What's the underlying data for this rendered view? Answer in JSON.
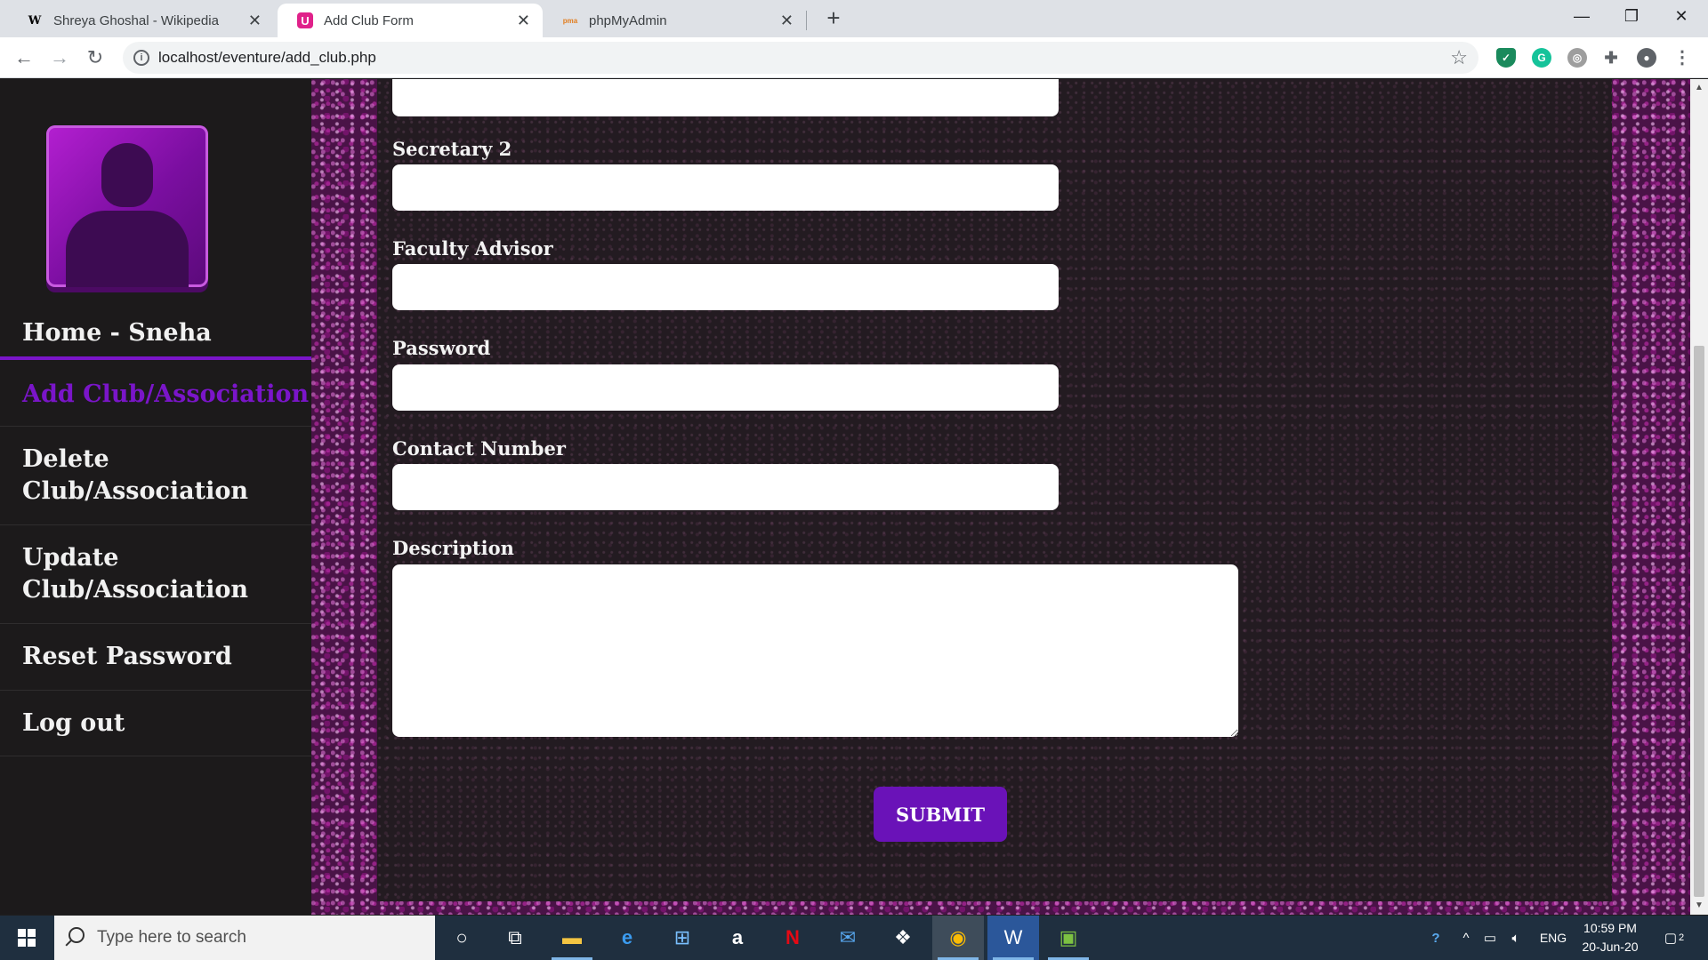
{
  "browser": {
    "tabs": [
      {
        "title": "Shreya Ghoshal - Wikipedia",
        "favicon": "W"
      },
      {
        "title": "Add Club Form",
        "favicon": "U"
      },
      {
        "title": "phpMyAdmin",
        "favicon": "pma"
      }
    ],
    "new_tab": "+",
    "url": "localhost/eventure/add_club.php"
  },
  "sidebar": {
    "avatar": "user-silhouette",
    "items": [
      {
        "label": "Home - Sneha"
      },
      {
        "label": "Add Club/Association"
      },
      {
        "label": "Delete\nClub/Association"
      },
      {
        "label": "Update\nClub/Association"
      },
      {
        "label": "Reset Password"
      },
      {
        "label": "Log out"
      }
    ]
  },
  "form": {
    "fields": [
      {
        "label": "Secretary 2",
        "value": ""
      },
      {
        "label": "Faculty Advisor",
        "value": ""
      },
      {
        "label": "Password",
        "value": ""
      },
      {
        "label": "Contact Number",
        "value": ""
      },
      {
        "label": "Description",
        "value": ""
      }
    ],
    "submit_label": "SUBMIT"
  },
  "taskbar": {
    "search_placeholder": "Type here to search",
    "language": "ENG",
    "time": "10:59 PM",
    "date": "20-Jun-20",
    "notification_count": "2"
  },
  "colors": {
    "accent_purple": "#7a15c9",
    "submit_bg": "#6a12b8",
    "sidebar_bg": "#1c1a1b"
  }
}
